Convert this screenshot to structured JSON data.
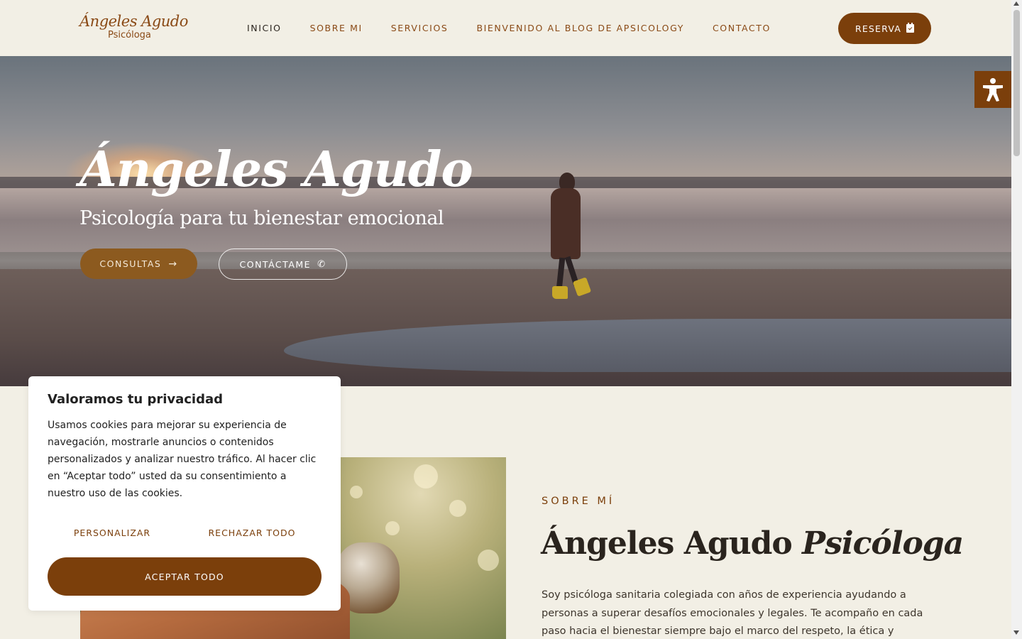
{
  "header": {
    "logo": {
      "name": "Ángeles Agudo",
      "subtitle": "Psicóloga"
    },
    "nav": [
      {
        "label": "INICIO",
        "active": true
      },
      {
        "label": "SOBRE MI",
        "active": false
      },
      {
        "label": "SERVICIOS",
        "active": false
      },
      {
        "label": "BIENVENIDO AL BLOG DE APSICOLOGY",
        "active": false
      },
      {
        "label": "CONTACTO",
        "active": false
      }
    ],
    "reserva_label": "RESERVA",
    "reserva_icon": "calendar-check-icon"
  },
  "hero": {
    "title": "Ángeles Agudo",
    "subtitle": "Psicología para tu bienestar emocional",
    "consultas_label": "CONSULTAS",
    "consultas_icon": "arrow-right-icon",
    "contact_label": "CONTÁCTAME",
    "contact_icon": "phone-icon"
  },
  "accessibility": {
    "icon": "accessibility-icon"
  },
  "about": {
    "label": "SOBRE MÍ",
    "title_main": "Ángeles Agudo",
    "title_italic": "Psicóloga",
    "text": "Soy psicóloga sanitaria colegiada con años de experiencia ayudando a personas a superar desafíos emocionales y legales. Te acompaño en cada paso hacia el bienestar siempre bajo el marco del respeto, la ética y profesionalidad."
  },
  "cookie": {
    "title": "Valoramos tu privacidad",
    "text": "Usamos cookies para mejorar su experiencia de navegación, mostrarle anuncios o contenidos personalizados y analizar nuestro tráfico. Al hacer clic en “Aceptar todo” usted da su consentimiento a nuestro uso de las cookies.",
    "personalizar_label": "PERSONALIZAR",
    "rechazar_label": "RECHAZAR TODO",
    "aceptar_label": "ACEPTAR TODO"
  },
  "colors": {
    "brand": "#7b3f0b",
    "background": "#f2efe5",
    "text_dark": "#2a241e"
  }
}
